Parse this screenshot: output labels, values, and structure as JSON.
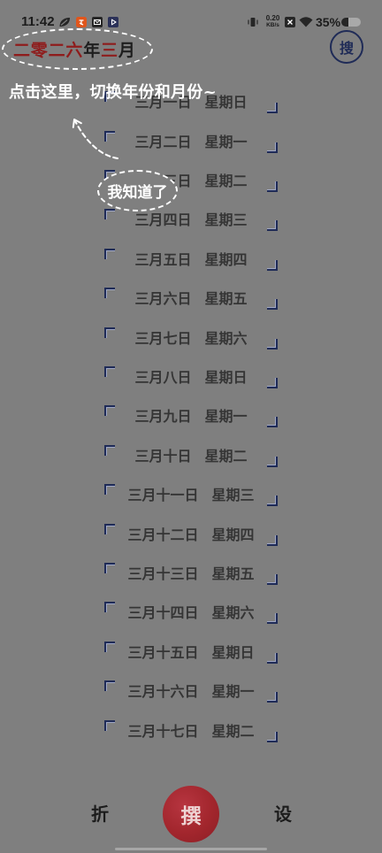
{
  "status_bar": {
    "time": "11:42",
    "net_speed_value": "0.20",
    "net_speed_unit": "KB/s",
    "battery_percent": "35%",
    "battery_level": 0.35,
    "icons_left": [
      "leaf-icon",
      "app-badge-icon",
      "mail-icon",
      "play-icon"
    ],
    "icons_right": [
      "vibrate-icon",
      "no-sim-icon",
      "wifi-icon",
      "battery-icon"
    ]
  },
  "header": {
    "title_parts": [
      {
        "text": "二零二六",
        "accent": true
      },
      {
        "text": "年",
        "accent": false
      },
      {
        "text": "三",
        "accent": true
      },
      {
        "text": "月",
        "accent": false
      }
    ],
    "search_label": "搜"
  },
  "days": [
    {
      "date": "三月一日",
      "weekday": "星期日"
    },
    {
      "date": "三月二日",
      "weekday": "星期一"
    },
    {
      "date": "三月三日",
      "weekday": "星期二"
    },
    {
      "date": "三月四日",
      "weekday": "星期三"
    },
    {
      "date": "三月五日",
      "weekday": "星期四"
    },
    {
      "date": "三月六日",
      "weekday": "星期五"
    },
    {
      "date": "三月七日",
      "weekday": "星期六"
    },
    {
      "date": "三月八日",
      "weekday": "星期日"
    },
    {
      "date": "三月九日",
      "weekday": "星期一"
    },
    {
      "date": "三月十日",
      "weekday": "星期二"
    },
    {
      "date": "三月十一日",
      "weekday": "星期三"
    },
    {
      "date": "三月十二日",
      "weekday": "星期四"
    },
    {
      "date": "三月十三日",
      "weekday": "星期五"
    },
    {
      "date": "三月十四日",
      "weekday": "星期六"
    },
    {
      "date": "三月十五日",
      "weekday": "星期日"
    },
    {
      "date": "三月十六日",
      "weekday": "星期一"
    },
    {
      "date": "三月十七日",
      "weekday": "星期二"
    }
  ],
  "guide": {
    "hint": "点击这里，切换年份和月份~",
    "dismiss_label": "我知道了"
  },
  "bottom_nav": {
    "left_label": "折",
    "center_label": "撰",
    "right_label": "设"
  },
  "colors": {
    "accent_red": "#8f1c1c",
    "navy": "#1f2b57",
    "button_red": "#a2262d",
    "page_bg": "#7f7f7f"
  }
}
